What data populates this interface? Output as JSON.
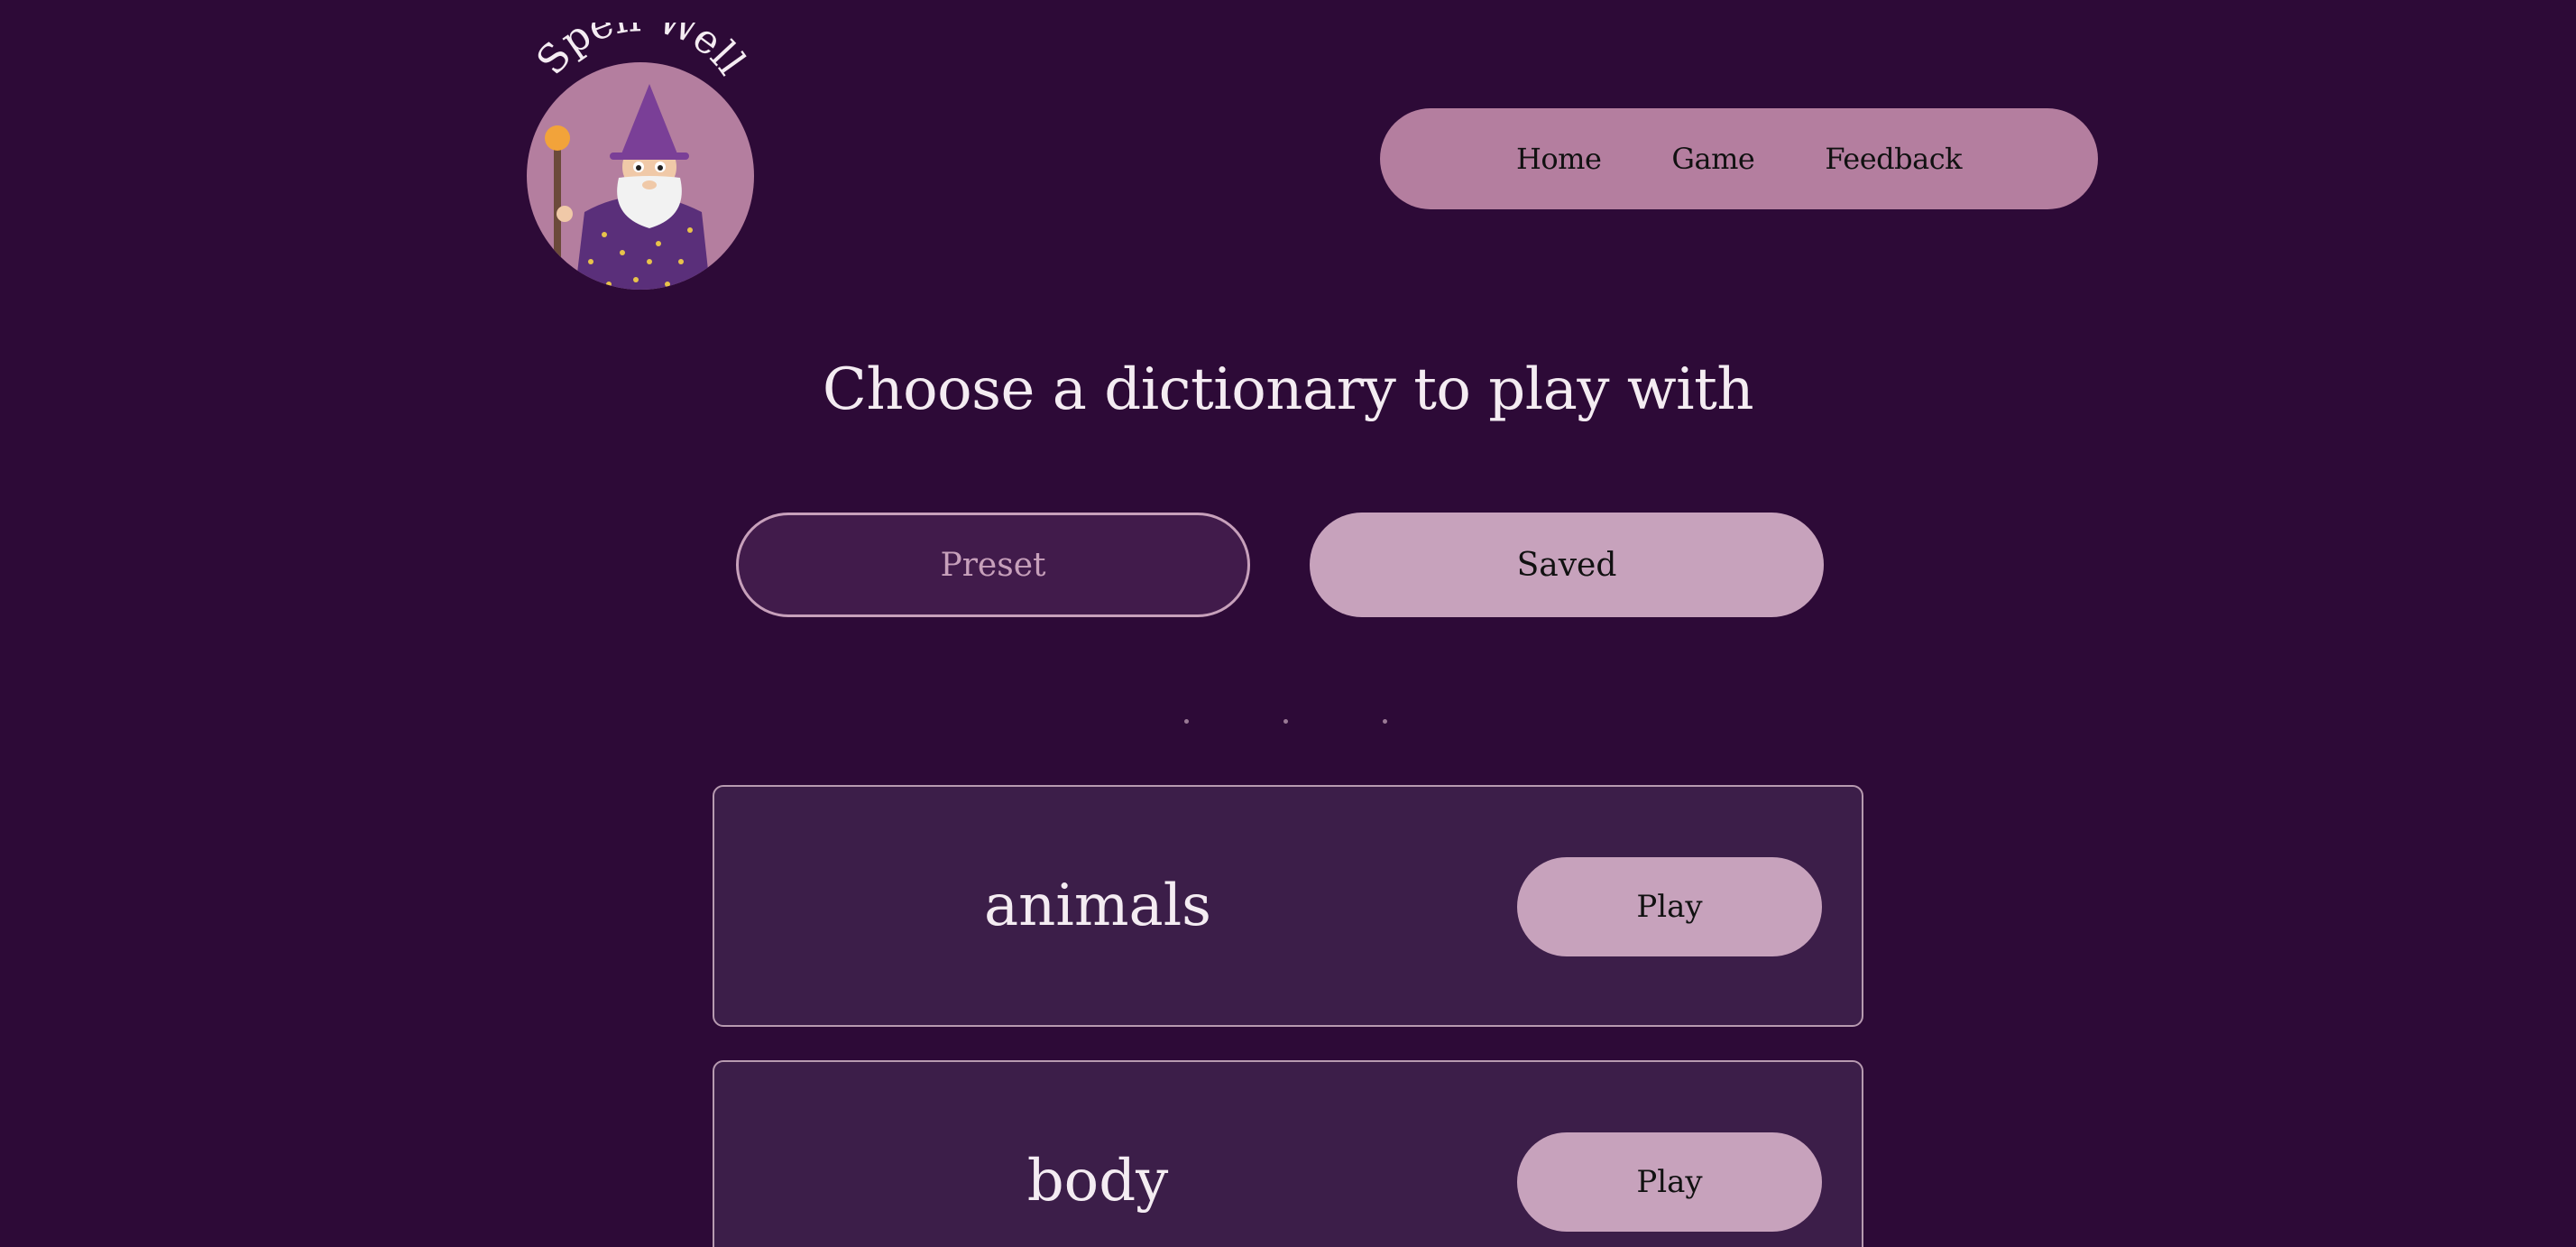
{
  "logo": {
    "text": "Spell Well",
    "icon": "wizard-icon",
    "colors": {
      "circle": "#b47e9f",
      "hat": "#7a3f97",
      "robe": "#5a2f7a",
      "beard": "#f2f2f2",
      "staff": "#6b4a3a",
      "orb": "#f2a33a"
    }
  },
  "nav": {
    "items": [
      {
        "label": "Home"
      },
      {
        "label": "Game"
      },
      {
        "label": "Feedback"
      }
    ]
  },
  "main": {
    "title": "Choose a dictionary to play with",
    "tabs": [
      {
        "label": "Preset",
        "selected": false
      },
      {
        "label": "Saved",
        "selected": true
      }
    ],
    "dictionaries": [
      {
        "name": "animals",
        "play_label": "Play"
      },
      {
        "name": "body",
        "play_label": "Play"
      }
    ]
  },
  "colors": {
    "background": "#2d0a37",
    "nav_bg": "#b47e9f",
    "card_bg": "#3c1e49",
    "button_bg": "#c7a2bc",
    "text_light": "#f4ecf2"
  }
}
